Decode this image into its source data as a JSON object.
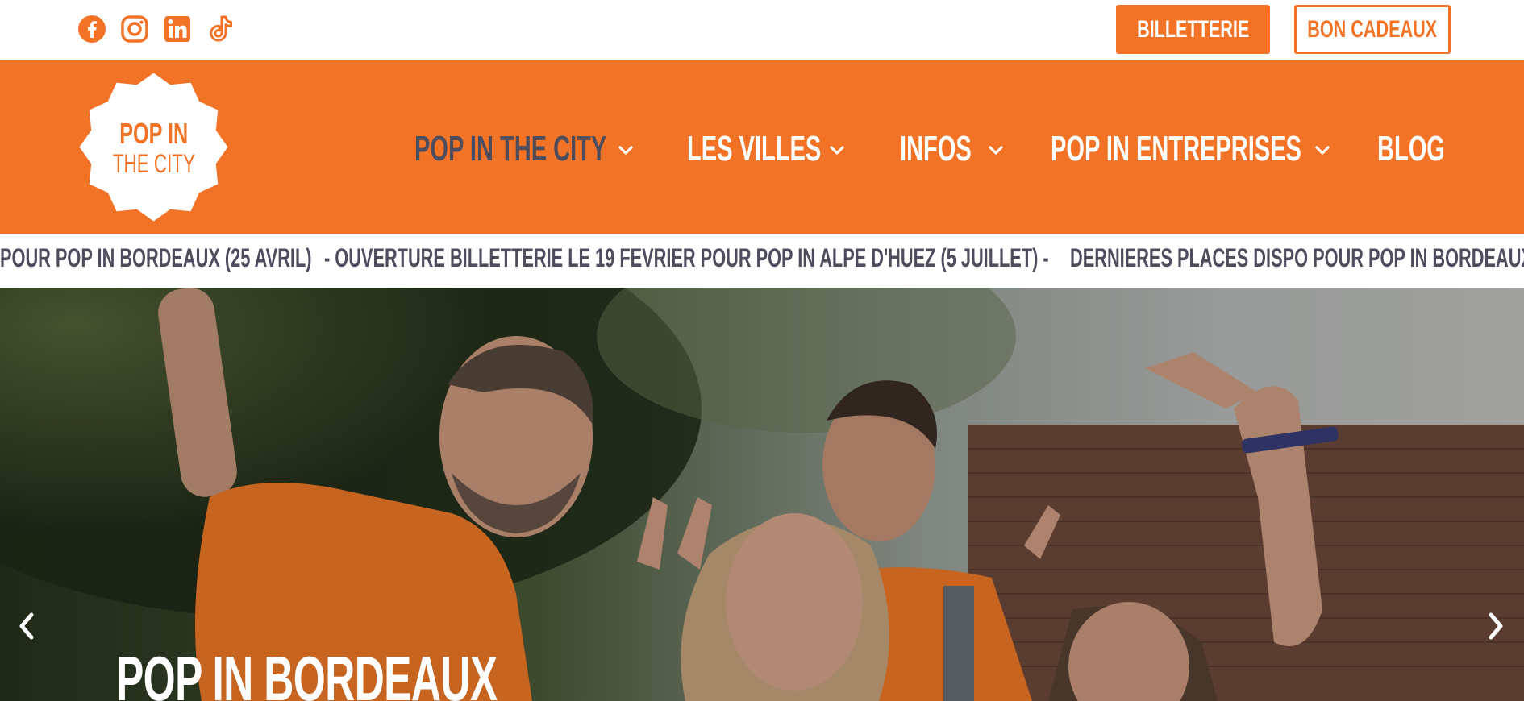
{
  "colors": {
    "brand_orange": "#f37326",
    "text_dark": "#4d4d5e",
    "white": "#ffffff"
  },
  "topbar": {
    "socials": [
      {
        "name": "facebook-icon"
      },
      {
        "name": "instagram-icon"
      },
      {
        "name": "linkedin-icon"
      },
      {
        "name": "tiktok-icon"
      }
    ],
    "billetterie_label": "BILLETTERIE",
    "bon_cadeaux_label": "BON CADEAUX"
  },
  "logo": {
    "line1": "POP IN",
    "line2": "THE CITY"
  },
  "nav": {
    "items": [
      {
        "label": "POP IN THE CITY",
        "has_dropdown": true,
        "active": true
      },
      {
        "label": "LES VILLES",
        "has_dropdown": true,
        "active": false
      },
      {
        "label": "INFOS",
        "has_dropdown": true,
        "active": false
      },
      {
        "label": "POP IN ENTREPRISES",
        "has_dropdown": true,
        "active": false
      },
      {
        "label": "BLOG",
        "has_dropdown": false,
        "active": false
      }
    ]
  },
  "ticker": {
    "items": [
      "POUR POP IN BORDEAUX (25 AVRIL)",
      "- OUVERTURE BILLETTERIE LE 19 FEVRIER POUR POP IN ALPE D'HUEZ (5 JUILLET) -",
      "DERNIERES PLACES DISPO POUR POP IN BORDEAUX"
    ]
  },
  "hero": {
    "title": "POP IN BORDEAUX",
    "prev_icon": "chevron-left-icon",
    "next_icon": "chevron-right-icon"
  }
}
